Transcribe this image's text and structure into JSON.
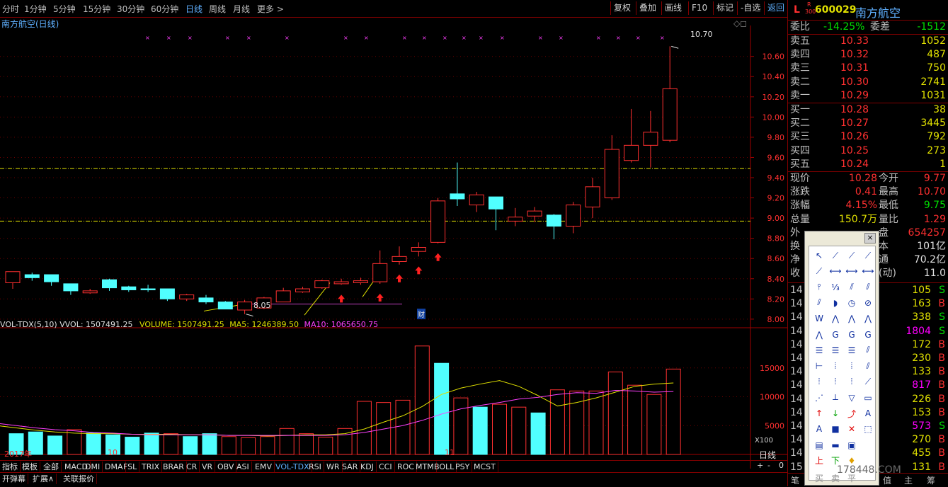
{
  "toolbar": {
    "periods": [
      "分时",
      "1分钟",
      "5分钟",
      "15分钟",
      "30分钟",
      "60分钟",
      "日线",
      "周线",
      "月线",
      "更多 >"
    ],
    "active_period": "日线",
    "buttons": [
      "复权",
      "叠加",
      "画线",
      "F10",
      "标记",
      "-自选",
      "返回"
    ]
  },
  "stock": {
    "title": "南方航空(日线)",
    "code": "600029",
    "name": "南方航空",
    "badge_l": "L",
    "badge_r": "R",
    "badge_300": "300"
  },
  "chart_labels": {
    "high_label": "10.70",
    "low_label": "8.05",
    "cai_label": "财",
    "price_ticks": [
      "10.60",
      "10.40",
      "10.20",
      "10.00",
      "9.80",
      "9.60",
      "9.40",
      "9.20",
      "9.00",
      "8.80",
      "8.60",
      "8.40",
      "8.20",
      "8.00"
    ],
    "vol_ticks": [
      "15000",
      "10000",
      "5000"
    ],
    "vol_unit": "X100",
    "date_labels": [
      "2017年",
      "10",
      "11"
    ],
    "indicator_header": {
      "name": "VOL-TDX(5,10)",
      "vvol": "VVOL: 1507491.25",
      "volume": "VOLUME: 1507491.25",
      "ma5": "MA5: 1246389.50",
      "ma10": "MA10: 1065650.75"
    }
  },
  "chart_data": {
    "type": "candlestick",
    "ylim": [
      7.95,
      10.85
    ],
    "candles": [
      {
        "o": 8.36,
        "c": 8.47,
        "h": 8.47,
        "l": 8.3
      },
      {
        "o": 8.44,
        "c": 8.41,
        "h": 8.46,
        "l": 8.38
      },
      {
        "o": 8.44,
        "c": 8.37,
        "h": 8.44,
        "l": 8.33
      },
      {
        "o": 8.35,
        "c": 8.28,
        "h": 8.35,
        "l": 8.24
      },
      {
        "o": 8.26,
        "c": 8.28,
        "h": 8.3,
        "l": 8.25
      },
      {
        "o": 8.39,
        "c": 8.31,
        "h": 8.4,
        "l": 8.28
      },
      {
        "o": 8.32,
        "c": 8.29,
        "h": 8.33,
        "l": 8.27
      },
      {
        "o": 8.3,
        "c": 8.29,
        "h": 8.34,
        "l": 8.27
      },
      {
        "o": 8.3,
        "c": 8.2,
        "h": 8.3,
        "l": 8.18
      },
      {
        "o": 8.2,
        "c": 8.24,
        "h": 8.25,
        "l": 8.18
      },
      {
        "o": 8.21,
        "c": 8.17,
        "h": 8.24,
        "l": 8.15
      },
      {
        "o": 8.17,
        "c": 8.1,
        "h": 8.18,
        "l": 8.1
      },
      {
        "o": 8.09,
        "c": 8.17,
        "h": 8.19,
        "l": 8.05
      },
      {
        "o": 8.11,
        "c": 8.21,
        "h": 8.22,
        "l": 8.1
      },
      {
        "o": 8.17,
        "c": 8.28,
        "h": 8.31,
        "l": 8.17
      },
      {
        "o": 8.27,
        "c": 8.3,
        "h": 8.32,
        "l": 8.26
      },
      {
        "o": 8.31,
        "c": 8.38,
        "h": 8.39,
        "l": 8.3
      },
      {
        "o": 8.35,
        "c": 8.37,
        "h": 8.4,
        "l": 8.34
      },
      {
        "o": 8.36,
        "c": 8.38,
        "h": 8.41,
        "l": 8.34
      },
      {
        "o": 8.37,
        "c": 8.55,
        "h": 8.68,
        "l": 8.35
      },
      {
        "o": 8.57,
        "c": 8.62,
        "h": 8.72,
        "l": 8.54
      },
      {
        "o": 8.67,
        "c": 8.71,
        "h": 8.76,
        "l": 8.62
      },
      {
        "o": 8.76,
        "c": 9.17,
        "h": 9.2,
        "l": 8.75
      },
      {
        "o": 9.24,
        "c": 9.19,
        "h": 9.55,
        "l": 9.12
      },
      {
        "o": 9.13,
        "c": 9.23,
        "h": 9.26,
        "l": 9.06
      },
      {
        "o": 9.21,
        "c": 9.09,
        "h": 9.21,
        "l": 8.88
      },
      {
        "o": 8.97,
        "c": 9.01,
        "h": 9.1,
        "l": 8.92
      },
      {
        "o": 9.02,
        "c": 9.07,
        "h": 9.11,
        "l": 8.96
      },
      {
        "o": 9.03,
        "c": 8.92,
        "h": 9.04,
        "l": 8.79
      },
      {
        "o": 8.92,
        "c": 9.13,
        "h": 9.16,
        "l": 8.85
      },
      {
        "o": 9.11,
        "c": 9.31,
        "h": 9.4,
        "l": 9.0
      },
      {
        "o": 9.2,
        "c": 9.68,
        "h": 9.82,
        "l": 9.18
      },
      {
        "o": 9.57,
        "c": 9.72,
        "h": 10.08,
        "l": 9.55
      },
      {
        "o": 9.72,
        "c": 9.85,
        "h": 10.06,
        "l": 9.5
      },
      {
        "o": 9.77,
        "c": 10.28,
        "h": 10.7,
        "l": 9.75
      }
    ],
    "volume": [
      5200,
      3600,
      3900,
      3200,
      4300,
      3700,
      3400,
      3000,
      3700,
      3600,
      3100,
      3600,
      3100,
      2900,
      3100,
      4500,
      3600,
      3000,
      4500,
      9200,
      9000,
      9400,
      18800,
      15800,
      9800,
      8200,
      8700,
      8200,
      7200,
      11200,
      11000,
      11000,
      14300,
      12000,
      10400,
      14800
    ],
    "ma5": [
      5000,
      4600,
      4200,
      3900,
      3700,
      3600,
      3600,
      3500,
      3500,
      3500,
      3400,
      3400,
      3300,
      3300,
      3200,
      3300,
      3400,
      3400,
      3600,
      4400,
      5600,
      6700,
      8300,
      10400,
      11500,
      12200,
      12800,
      11800,
      10200,
      8400,
      9000,
      9800,
      10800,
      11800,
      12200,
      12400
    ],
    "ma10": [
      5400,
      5000,
      4600,
      4300,
      4100,
      3800,
      3700,
      3500,
      3400,
      3400,
      3400,
      3400,
      3300,
      3300,
      3300,
      3300,
      3300,
      3300,
      3400,
      3800,
      4400,
      5000,
      5900,
      7000,
      7900,
      8500,
      9000,
      9600,
      9900,
      10400,
      10700,
      10600,
      11100,
      11000,
      10800,
      10900
    ],
    "yellow_lines": [
      9.49,
      8.97
    ],
    "purple_support": 8.15,
    "vol_ylim": [
      0,
      20000
    ]
  },
  "quote": {
    "weibi_label": "委比",
    "weibi": "-14.25%",
    "weicha_label": "委差",
    "weicha": "-1512",
    "asks": [
      {
        "label": "卖五",
        "price": "10.33",
        "vol": "1052"
      },
      {
        "label": "卖四",
        "price": "10.32",
        "vol": "487"
      },
      {
        "label": "卖三",
        "price": "10.31",
        "vol": "750"
      },
      {
        "label": "卖二",
        "price": "10.30",
        "vol": "2741"
      },
      {
        "label": "卖一",
        "price": "10.29",
        "vol": "1031"
      }
    ],
    "bids": [
      {
        "label": "买一",
        "price": "10.28",
        "vol": "38"
      },
      {
        "label": "买二",
        "price": "10.27",
        "vol": "3445"
      },
      {
        "label": "买三",
        "price": "10.26",
        "vol": "792"
      },
      {
        "label": "买四",
        "price": "10.25",
        "vol": "273"
      },
      {
        "label": "买五",
        "price": "10.24",
        "vol": "1"
      }
    ],
    "stats": [
      {
        "l1": "现价",
        "v1": "10.28",
        "l2": "今开",
        "v2": "9.77"
      },
      {
        "l1": "涨跌",
        "v1": "0.41",
        "l2": "最高",
        "v2": "10.70"
      },
      {
        "l1": "涨幅",
        "v1": "4.15%",
        "l2": "最低",
        "v2": "9.75"
      },
      {
        "l1": "总量",
        "v1": "150.7万",
        "l2": "量比",
        "v2": "1.29"
      },
      {
        "l1": "外",
        "v1": "",
        "l2": "盘",
        "v2": "654257"
      },
      {
        "l1": "换",
        "v1": "",
        "l2": "本",
        "v2": "101亿"
      },
      {
        "l1": "净",
        "v1": "",
        "l2": "通",
        "v2": "70.2亿"
      },
      {
        "l1": "收",
        "v1": "",
        "l2": "(动)",
        "v2": "11.0"
      }
    ],
    "ticks": [
      {
        "t": "14",
        "v": "105",
        "s": "S"
      },
      {
        "t": "14",
        "v": "163",
        "s": "B"
      },
      {
        "t": "14",
        "v": "338",
        "s": "S"
      },
      {
        "t": "14",
        "v": "1804",
        "s": "S"
      },
      {
        "t": "14",
        "v": "172",
        "s": "B"
      },
      {
        "t": "14",
        "v": "230",
        "s": "B"
      },
      {
        "t": "14",
        "v": "133",
        "s": "B"
      },
      {
        "t": "14",
        "v": "817",
        "s": "B"
      },
      {
        "t": "14",
        "v": "226",
        "s": "B"
      },
      {
        "t": "14",
        "v": "153",
        "s": "B"
      },
      {
        "t": "14",
        "v": "573",
        "s": "S"
      },
      {
        "t": "14",
        "v": "270",
        "s": "B"
      },
      {
        "t": "14",
        "v": "455",
        "s": "B"
      },
      {
        "t": "15",
        "v": "131",
        "s": "B"
      }
    ],
    "panel_bottom": [
      "笔",
      "值",
      "主",
      "筹"
    ]
  },
  "tabs": [
    "指标",
    "模板",
    "全部",
    "MACD",
    "DMI",
    "DMA",
    "FSL",
    "TRIX",
    "BRAR",
    "CR",
    "VR",
    "OBV",
    "ASI",
    "EMV",
    "VOL-TDX",
    "RSI",
    "WR",
    "SAR",
    "KDJ",
    "CCI",
    "ROC",
    "MTM",
    "BOLL",
    "PSY",
    "MCST"
  ],
  "active_tab": "VOL-TDX",
  "zoom_controls": [
    "+",
    "-",
    "0"
  ],
  "zhouxian": "日线",
  "bottom_links": [
    "开弹幕",
    "扩展∧",
    "关联报价"
  ],
  "toolbox": {
    "close": "×",
    "bottom_labels": [
      "买",
      "卖",
      "平"
    ]
  },
  "watermark": "178448.COM"
}
